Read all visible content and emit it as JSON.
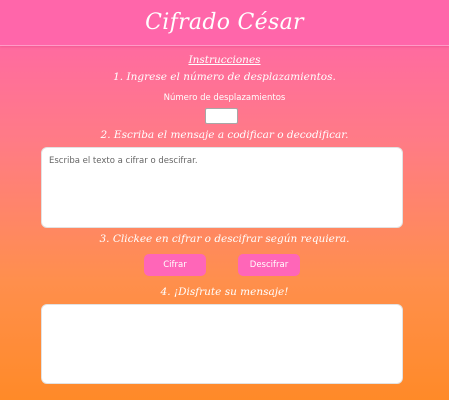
{
  "header": {
    "title": "Cifrado César"
  },
  "instructions": {
    "title": "Instrucciones",
    "step1": "1. Ingrese el número de desplazamientos.",
    "shift_label": "Número de desplazamientos",
    "shift_value": "",
    "step2": "2. Escriba el mensaje a codificar o decodificar.",
    "input_placeholder": "Escriba el texto a cifrar o descifrar.",
    "step3": "3. Clickee en cifrar o descifrar según requiera.",
    "step4": "4. ¡Disfrute su mensaje!"
  },
  "buttons": {
    "encrypt_label": "Cifrar",
    "decrypt_label": "Descifrar"
  },
  "output": {
    "value": ""
  },
  "colors": {
    "header_bg": "#ff66aa",
    "gradient_top": "#ff63ad",
    "gradient_bottom": "#ff8a28",
    "button_bg": "#ff66b8"
  }
}
